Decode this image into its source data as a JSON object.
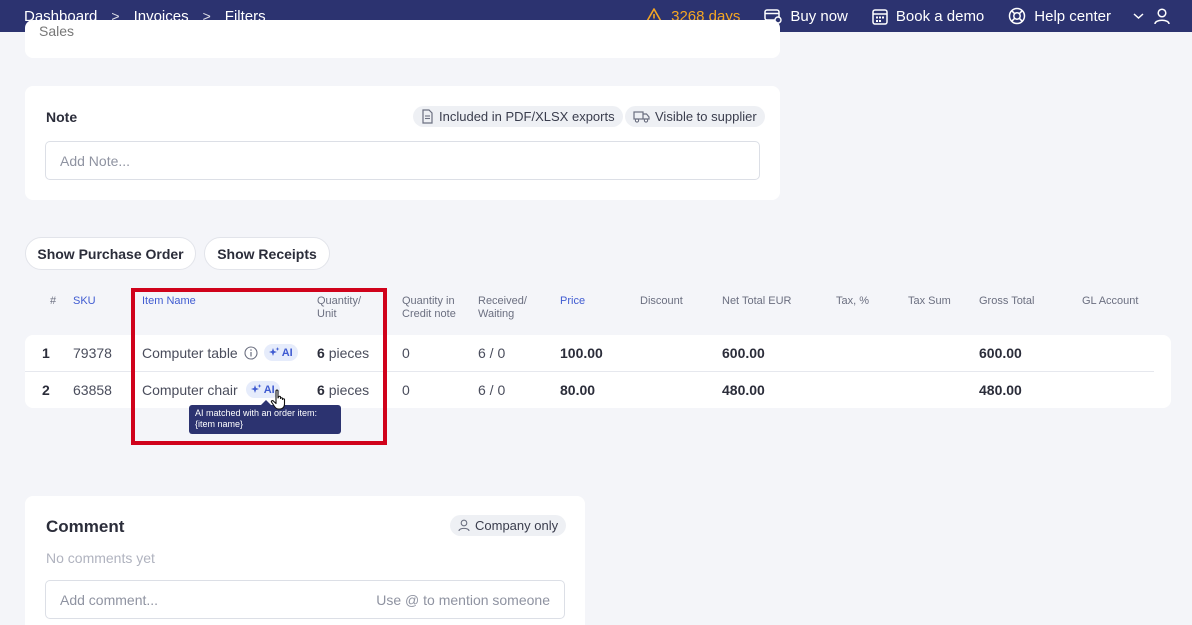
{
  "topbar": {
    "breadcrumbs": [
      "Dashboard",
      "Invoices",
      "Filters"
    ],
    "trial_days": "3268 days",
    "buy_now": "Buy now",
    "book_demo": "Book a demo",
    "help_center": "Help center",
    "colors": {
      "bar": "#2c3370",
      "warning": "#f5a623"
    }
  },
  "sales_label": "Sales",
  "note": {
    "title": "Note",
    "chip_pdf": "Included in PDF/XLSX exports",
    "chip_supplier": "Visible to supplier",
    "placeholder": "Add Note..."
  },
  "buttons": {
    "show_po": "Show Purchase Order",
    "show_receipts": "Show Receipts"
  },
  "table": {
    "headers": {
      "num": "#",
      "sku": "SKU",
      "item_name": "Item Name",
      "qty_unit_1": "Quantity/",
      "qty_unit_2": "Unit",
      "qty_credit_1": "Quantity in",
      "qty_credit_2": "Credit note",
      "received_1": "Received/",
      "received_2": "Waiting",
      "price": "Price",
      "discount": "Discount",
      "net_total": "Net Total EUR",
      "tax_pct": "Tax, %",
      "tax_sum": "Tax Sum",
      "gross_total": "Gross Total",
      "gl_account": "GL Account"
    },
    "rows": [
      {
        "num": "1",
        "sku": "79378",
        "item_name": "Computer table",
        "ai": "AI",
        "qty": "6",
        "unit": "pieces",
        "credit_qty": "0",
        "received": "6 / 0",
        "price": "100.00",
        "net_total": "600.00",
        "gross_total": "600.00"
      },
      {
        "num": "2",
        "sku": "63858",
        "item_name": "Computer chair",
        "ai": "AI",
        "qty": "6",
        "unit": "pieces",
        "credit_qty": "0",
        "received": "6 / 0",
        "price": "80.00",
        "net_total": "480.00",
        "gross_total": "480.00"
      }
    ],
    "tooltip_line1": "AI matched with an order item:",
    "tooltip_line2": "{item name}"
  },
  "comment": {
    "title": "Comment",
    "chip": "Company only",
    "empty": "No comments yet",
    "placeholder": "Add comment...",
    "mention_hint": "Use @ to mention someone"
  }
}
